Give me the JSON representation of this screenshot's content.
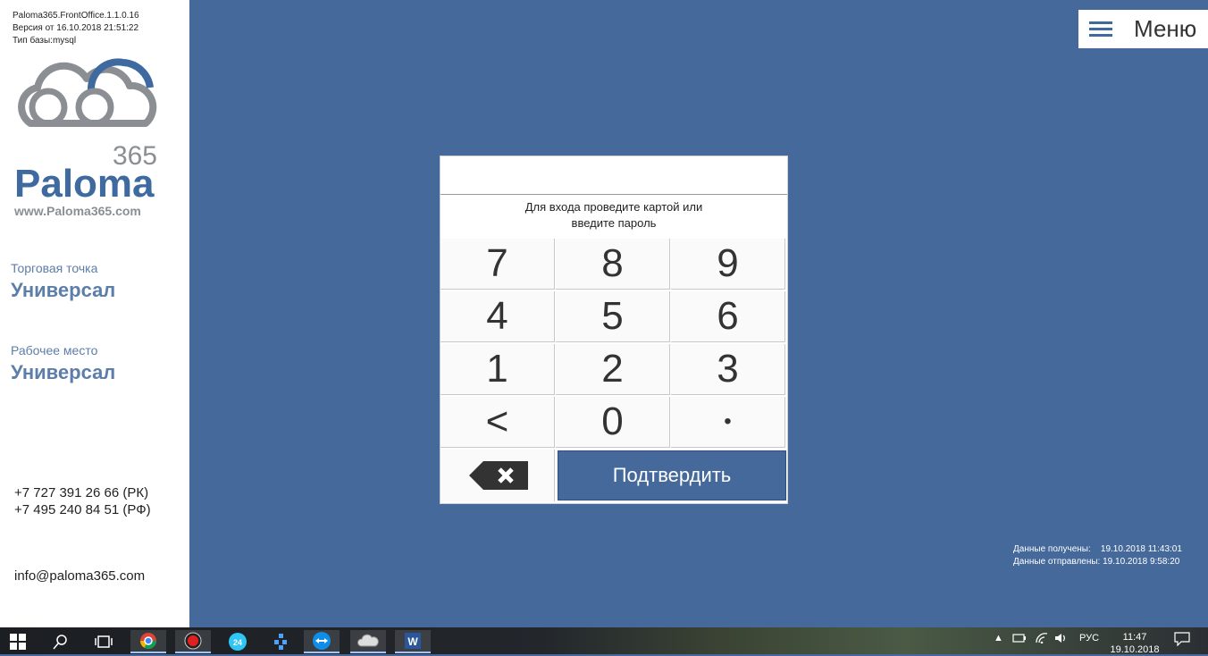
{
  "app": {
    "version_line": "Paloma365.FrontOffice.1.1.0.16",
    "build_line": "Версия от 16.10.2018 21:51:22",
    "db_line": "Тип базы:mysql"
  },
  "logo": {
    "number": "365",
    "name": "Paloma",
    "url": "www.Paloma365.com"
  },
  "sidebar": {
    "point_label": "Торговая точка",
    "point_value": "Универсал",
    "workplace_label": "Рабочее место",
    "workplace_value": "Универсал",
    "phone_kz": "+7 727 391 26 66 (РК)",
    "phone_ru": "+7 495 240 84 51 (РФ)",
    "email": "info@paloma365.com"
  },
  "menu": {
    "label": "Меню"
  },
  "login": {
    "password_value": "",
    "prompt_line1": "Для входа проведите картой или",
    "prompt_line2": "введите пароль",
    "keys": [
      "7",
      "8",
      "9",
      "4",
      "5",
      "6",
      "1",
      "2",
      "3",
      "<",
      "0",
      "•"
    ],
    "confirm_label": "Подтвердить"
  },
  "sync": {
    "received_label": "Данные получены:",
    "received_value": "19.10.2018 11:43:01",
    "sent_label": "Данные отправлены:",
    "sent_value": "19.10.2018 9:58:20"
  },
  "taskbar": {
    "tray_lang": "РУС",
    "clock_time": "11:47",
    "clock_date": "19.10.2018",
    "icons": [
      "windows-start-icon",
      "search-icon",
      "task-view-icon",
      "chrome-icon",
      "record-icon",
      "bitrix24-icon",
      "network-icon",
      "teamviewer-icon",
      "paloma-icon",
      "word-icon"
    ]
  },
  "colors": {
    "background": "#45699a",
    "accent": "#3e6aa0",
    "sidebar_text": "#5c7ea9"
  }
}
